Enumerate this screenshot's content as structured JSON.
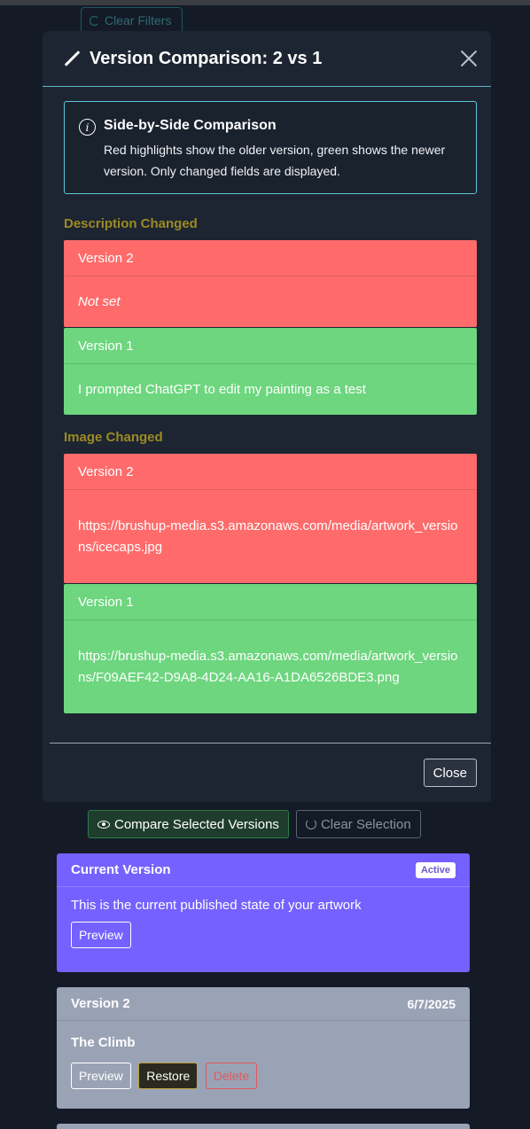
{
  "background": {
    "clear_filters_label": "Clear Filters",
    "compare_button_label": "Compare Selected Versions",
    "clear_selection_label": "Clear Selection",
    "current_version": {
      "title": "Current Version",
      "badge": "Active",
      "description": "This is the current published state of your artwork",
      "preview_label": "Preview"
    },
    "version2_card": {
      "title": "Version 2",
      "date": "6/7/2025",
      "artwork_title": "The Climb",
      "preview_label": "Preview",
      "restore_label": "Restore",
      "delete_label": "Delete"
    }
  },
  "modal": {
    "title": "Version Comparison: 2 vs 1",
    "info": {
      "title": "Side-by-Side Comparison",
      "text": "Red highlights show the older version, green shows the newer version. Only changed fields are displayed."
    },
    "sections": [
      {
        "label": "Description Changed",
        "old": {
          "version": "Version 2",
          "value": "Not set"
        },
        "new": {
          "version": "Version 1",
          "value": "I prompted ChatGPT to edit my painting as a test"
        }
      },
      {
        "label": "Image Changed",
        "old": {
          "version": "Version 2",
          "value": "https://brushup-media.s3.amazonaws.com/media/artwork_versions/icecaps.jpg"
        },
        "new": {
          "version": "Version 1",
          "value": "https://brushup-media.s3.amazonaws.com/media/artwork_versions/F09AEF42-D9A8-4D24-AA16-A1DA6526BDE3.png"
        }
      }
    ],
    "close_label": "Close"
  },
  "colors": {
    "old_version": "#ff6b6b",
    "new_version": "#6dd67e",
    "current_card": "#7561ff",
    "section_label": "#9c8a22"
  }
}
